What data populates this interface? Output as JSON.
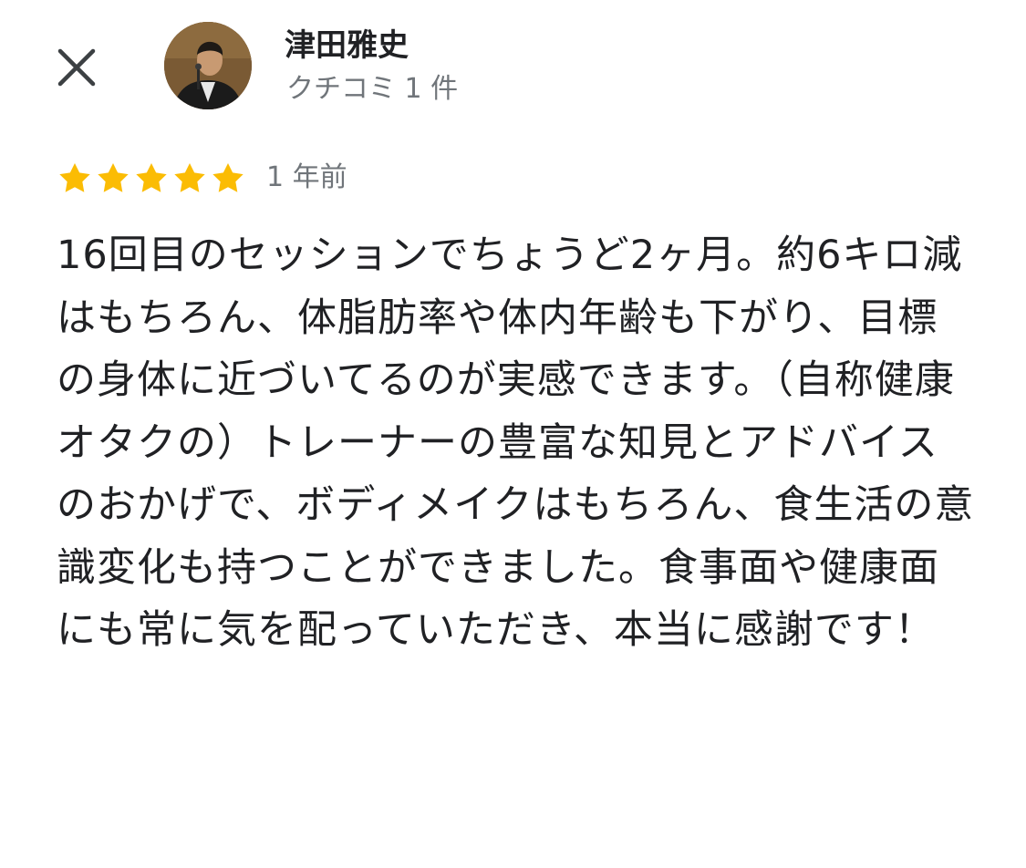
{
  "header": {
    "close_icon": "close-icon",
    "avatar_icon": "reviewer-avatar",
    "reviewer_name": "津田雅史",
    "review_count": "クチコミ 1 件"
  },
  "review": {
    "rating": 5,
    "rating_max": 5,
    "star_color": "#fbbc04",
    "date": "1 年前",
    "text": "16回目のセッションでちょうど2ヶ月。約6キロ減はもちろん、体脂肪率や体内年齢も下がり、目標の身体に近づいてるのが実感できます。（自称健康オタクの）トレーナーの豊富な知見とアドバイスのおかげで、ボディメイクはもちろん、食生活の意識変化も持つことができました。食事面や健康面にも常に気を配っていただき、本当に感謝です！"
  }
}
